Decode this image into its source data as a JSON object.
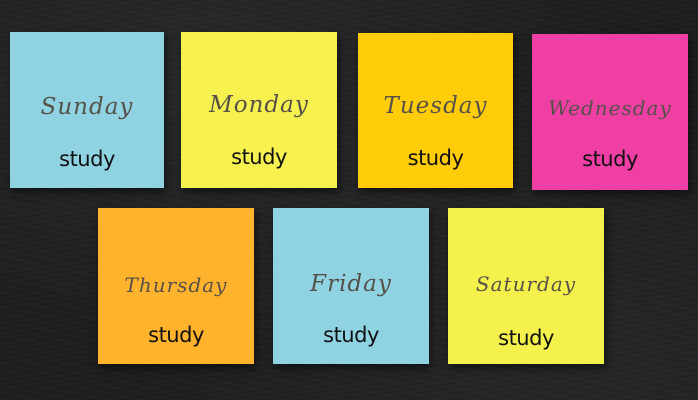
{
  "notes": [
    {
      "day": "Sunday",
      "task": "study",
      "color": "#8fd2e2"
    },
    {
      "day": "Monday",
      "task": "study",
      "color": "#f6f14e"
    },
    {
      "day": "Tuesday",
      "task": "study",
      "color": "#ffcc0a"
    },
    {
      "day": "Wednesday",
      "task": "study",
      "color": "#ef3fa4"
    },
    {
      "day": "Thursday",
      "task": "study",
      "color": "#ffb32d"
    },
    {
      "day": "Friday",
      "task": "study",
      "color": "#8fd2e2"
    },
    {
      "day": "Saturday",
      "task": "study",
      "color": "#f4f14c"
    }
  ]
}
